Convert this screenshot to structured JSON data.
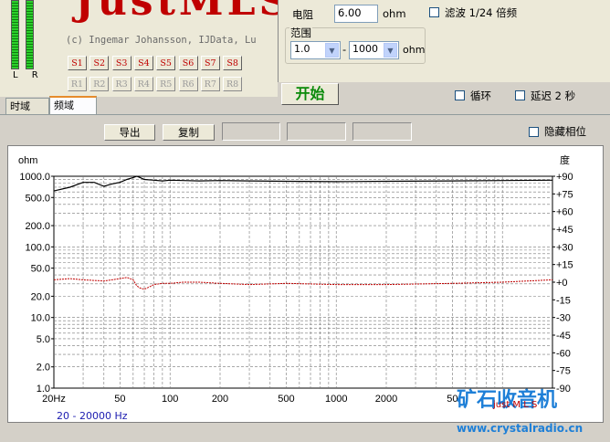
{
  "app": {
    "logo_text": "JustMLS",
    "copyright": "(c) Ingemar Johansson, IJData, Lu",
    "meter_labels": "L R"
  },
  "speaker_buttons": [
    "S1",
    "S2",
    "S3",
    "S4",
    "S5",
    "S6",
    "S7",
    "S8"
  ],
  "ref_buttons": [
    "R1",
    "R2",
    "R3",
    "R4",
    "R5",
    "R6",
    "R7",
    "R8"
  ],
  "tabs": {
    "time": "时域",
    "freq": "频域"
  },
  "settings": {
    "resistance_label": "电阻",
    "resistance_value": "6.00",
    "resistance_unit": "ohm",
    "filter_label": "滤波 1/24 倍频",
    "range_label": "范围",
    "range_min": "1.0",
    "range_sep": "-",
    "range_max": "1000",
    "range_unit": "ohm",
    "start_label": "开始",
    "loop_label": "循环",
    "delay_label": "延迟 2 秒"
  },
  "toolbar": {
    "export_label": "导出",
    "copy_label": "复制",
    "hide_phase_label": "隐藏相位"
  },
  "bottom": {
    "range_text": "20  - 20000 Hz"
  },
  "watermark": {
    "text": "矿石收音机",
    "url": "www.crystalradio.cn",
    "sub": "just M L S"
  },
  "chart_data": {
    "type": "line",
    "ylabel": "ohm",
    "y2label": "度",
    "xscale": "log",
    "yscale": "log",
    "xlim": [
      20,
      20000
    ],
    "ylim": [
      1.0,
      1000.0
    ],
    "y2lim": [
      -90,
      90
    ],
    "x_ticks": [
      "20Hz",
      "50",
      "100",
      "200",
      "500",
      "1000",
      "2000",
      "50"
    ],
    "x_tick_values": [
      20,
      50,
      100,
      200,
      500,
      1000,
      2000,
      5000
    ],
    "y_ticks": [
      "1000.0",
      "500.0",
      "200.0",
      "100.0",
      "50.0",
      "20.0",
      "10.0",
      "5.0",
      "2.0",
      "1.0"
    ],
    "y_tick_values": [
      1000,
      500,
      200,
      100,
      50,
      20,
      10,
      5,
      2,
      1
    ],
    "y2_ticks": [
      "+90",
      "+75",
      "+60",
      "+45",
      "+30",
      "+15",
      "+0",
      "-15",
      "-30",
      "-45",
      "-60",
      "-75",
      "-90"
    ],
    "y2_tick_values": [
      90,
      75,
      60,
      45,
      30,
      15,
      0,
      -15,
      -30,
      -45,
      -60,
      -75,
      -90
    ],
    "grid": true,
    "series": [
      {
        "axis": "left",
        "color": "#000000",
        "x": [
          20,
          25,
          30,
          35,
          40,
          45,
          50,
          55,
          60,
          63,
          66,
          70,
          80,
          90,
          100,
          120,
          150,
          200,
          300,
          500,
          1000,
          2000,
          5000,
          10000,
          20000
        ],
        "y": [
          620,
          700,
          820,
          820,
          720,
          780,
          820,
          900,
          960,
          1000,
          960,
          900,
          880,
          860,
          880,
          870,
          860,
          870,
          860,
          850,
          840,
          850,
          860,
          870,
          880
        ]
      },
      {
        "axis": "right",
        "color": "#c00000",
        "x": [
          20,
          25,
          30,
          40,
          50,
          55,
          60,
          63,
          66,
          70,
          75,
          80,
          90,
          100,
          120,
          150,
          200,
          300,
          500,
          1000,
          2000,
          5000,
          10000,
          20000
        ],
        "y": [
          2,
          3,
          2,
          1,
          3,
          4,
          2,
          -3,
          -5,
          -6,
          -4,
          -2,
          -1,
          -1,
          0,
          0,
          -1,
          -2,
          -1,
          -2,
          -2,
          -1,
          0,
          2
        ]
      }
    ]
  }
}
